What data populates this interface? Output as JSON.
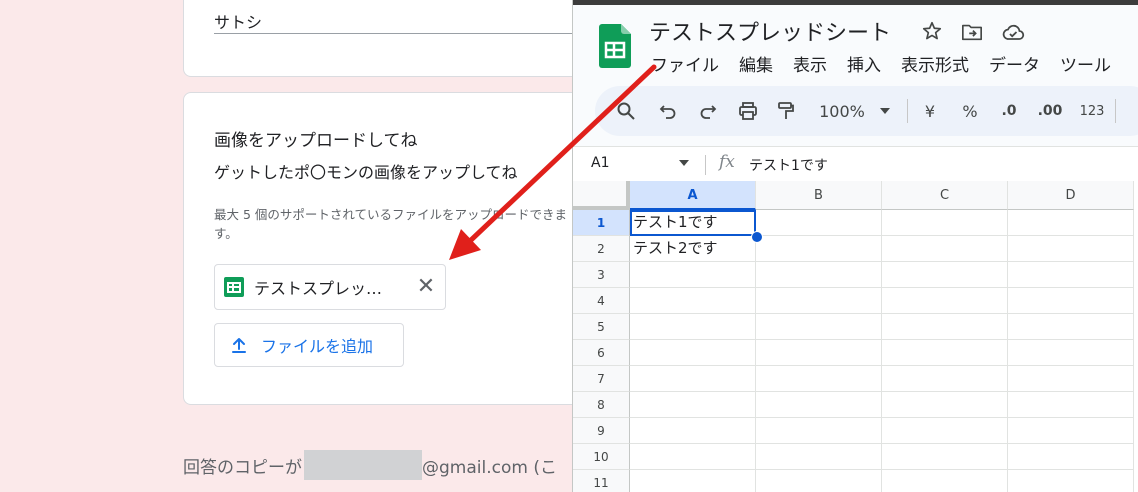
{
  "form": {
    "name_value": "サトシ",
    "question_title": "画像をアップロードしてね",
    "question_desc": "ゲットしたポ〇モンの画像をアップしてね",
    "upload_note": "最大 5 個のサポートされているファイルをアップロードできます。",
    "file_chip_name": "テストスプレッ…",
    "add_file_label": "ファイルを追加",
    "footer_prefix": "回答のコピーが",
    "footer_suffix": "@gmail.com (こ"
  },
  "sheets": {
    "title": "テストスプレッドシート",
    "menu": [
      "ファイル",
      "編集",
      "表示",
      "挿入",
      "表示形式",
      "データ",
      "ツール"
    ],
    "toolbar": {
      "zoom": "100%",
      "currency": "¥",
      "percent": "%",
      "dec_decrease": ".0",
      "dec_increase": ".00",
      "number_format": "123"
    },
    "name_box": "A1",
    "fx_label": "fx",
    "formula_content": "テスト1です",
    "columns": [
      "A",
      "B",
      "C",
      "D"
    ],
    "rows": [
      "1",
      "2",
      "3",
      "4",
      "5",
      "6",
      "7",
      "8",
      "9",
      "10",
      "11"
    ],
    "cells": {
      "A1": "テスト1です",
      "A2": "テスト2です"
    }
  },
  "colors": {
    "form_background": "#fbe9ea",
    "sheets_green": "#0f9d58",
    "selection_blue": "#0b57d0",
    "link_blue": "#1a73e8",
    "arrow_red": "#e0201b"
  }
}
